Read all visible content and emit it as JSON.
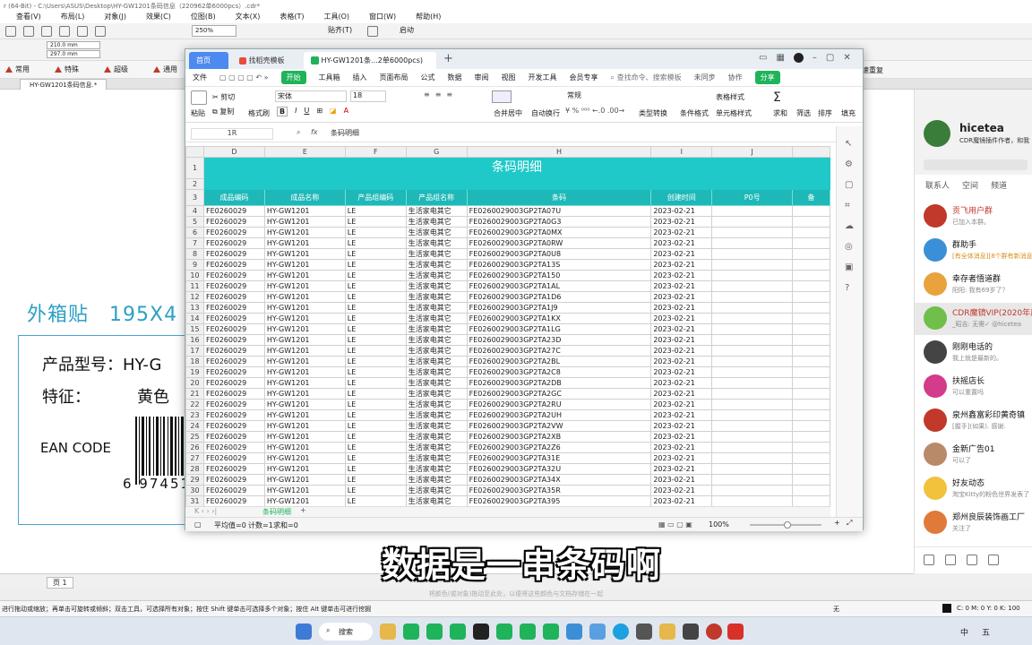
{
  "coreldraw": {
    "title_bar": "r (64-Bit) - C:\\Users\\ASUS\\Desktop\\HY-GW1201条码信息（220962单6000pcs）.cdr*",
    "menu": [
      "查看(V)",
      "布局(L)",
      "对象(J)",
      "效果(C)",
      "位图(B)",
      "文本(X)",
      "表格(T)",
      "工具(O)",
      "窗口(W)",
      "帮助(H)"
    ],
    "zoom": "250%",
    "width_value": "210.0 mm",
    "height_value": "297.0 mm",
    "paste_label": "贴齐(T)",
    "launch_label": "启动",
    "plugins": [
      "常用",
      "特殊",
      "超级",
      "通用"
    ],
    "plugin_right": "速重复",
    "doc_tab": "HY-GW1201条码信息.*",
    "page_tab": "页 1",
    "status_hint": "将颜色(或对象)拖动至此处，以便将这些颜色与文档存储在一起",
    "status_text": "进行拖动或缩放；再单击可旋转或倾斜；双击工具，可选择所有对象；按住 Shift 键单击可选择多个对象；按住 Alt 键单击可进行挖掘",
    "fill_none": "无",
    "color_readout": "C: 0 M: 0 Y: 0 K: 100"
  },
  "label": {
    "title": "外箱贴　195X4",
    "model_label": "产品型号：HY-G",
    "feature_label": "特征：",
    "feature_value": "黄色",
    "ean": "EAN CODE",
    "barcode_digits": "6 97451"
  },
  "wps": {
    "tabs": {
      "home": "首页",
      "template": "找稻壳模板",
      "file": "HY-GW1201条...2单6000pcs)"
    },
    "menu": [
      "文件",
      "开始",
      "工具箱",
      "插入",
      "页面布局",
      "公式",
      "数据",
      "审阅",
      "视图",
      "开发工具",
      "会员专享"
    ],
    "search": "查找命令、搜索模板",
    "unsync": "未同步",
    "collab": "协作",
    "share": "分享",
    "ribbon": {
      "paste": "粘贴",
      "cut": "剪切",
      "copy": "复制",
      "format_painter": "格式刷",
      "font": "宋体",
      "font_size": "18",
      "merge": "合并居中",
      "wrap": "自动换行",
      "number_format": "常规",
      "type_convert": "类型转换",
      "cond_format": "条件格式",
      "table_style": "表格样式",
      "cell_style": "单元格样式",
      "sum": "求和",
      "filter": "筛选",
      "sort": "排序",
      "fill": "填充",
      "bold": "B",
      "italic": "I",
      "underline": "U"
    },
    "cell_ref": "1R",
    "formula_fx": "fx",
    "formula": "条码明细",
    "columns": [
      "D",
      "E",
      "F",
      "G",
      "H",
      "I",
      "J"
    ],
    "sheet_title": "条码明细",
    "headers": [
      "成品编码",
      "成品名称",
      "产品组编码",
      "产品组名称",
      "条码",
      "创建时间",
      "P0号",
      "备"
    ],
    "rows": [
      [
        "4",
        "FE0260029",
        "HY-GW1201",
        "LE",
        "生活家电其它",
        "FE0260029003GP2TA07U",
        "2023-02-21"
      ],
      [
        "5",
        "FE0260029",
        "HY-GW1201",
        "LE",
        "生活家电其它",
        "FE0260029003GP2TA0G3",
        "2023-02-21"
      ],
      [
        "6",
        "FE0260029",
        "HY-GW1201",
        "LE",
        "生活家电其它",
        "FE0260029003GP2TA0MX",
        "2023-02-21"
      ],
      [
        "7",
        "FE0260029",
        "HY-GW1201",
        "LE",
        "生活家电其它",
        "FE0260029003GP2TA0RW",
        "2023-02-21"
      ],
      [
        "8",
        "FE0260029",
        "HY-GW1201",
        "LE",
        "生活家电其它",
        "FE0260029003GP2TA0U8",
        "2023-02-21"
      ],
      [
        "9",
        "FE0260029",
        "HY-GW1201",
        "LE",
        "生活家电其它",
        "FE0260029003GP2TA13S",
        "2023-02-21"
      ],
      [
        "10",
        "FE0260029",
        "HY-GW1201",
        "LE",
        "生活家电其它",
        "FE0260029003GP2TA150",
        "2023-02-21"
      ],
      [
        "11",
        "FE0260029",
        "HY-GW1201",
        "LE",
        "生活家电其它",
        "FE0260029003GP2TA1AL",
        "2023-02-21"
      ],
      [
        "12",
        "FE0260029",
        "HY-GW1201",
        "LE",
        "生活家电其它",
        "FE0260029003GP2TA1D6",
        "2023-02-21"
      ],
      [
        "13",
        "FE0260029",
        "HY-GW1201",
        "LE",
        "生活家电其它",
        "FE0260029003GP2TA1J9",
        "2023-02-21"
      ],
      [
        "14",
        "FE0260029",
        "HY-GW1201",
        "LE",
        "生活家电其它",
        "FE0260029003GP2TA1KX",
        "2023-02-21"
      ],
      [
        "15",
        "FE0260029",
        "HY-GW1201",
        "LE",
        "生活家电其它",
        "FE0260029003GP2TA1LG",
        "2023-02-21"
      ],
      [
        "16",
        "FE0260029",
        "HY-GW1201",
        "LE",
        "生活家电其它",
        "FE0260029003GP2TA23D",
        "2023-02-21"
      ],
      [
        "17",
        "FE0260029",
        "HY-GW1201",
        "LE",
        "生活家电其它",
        "FE0260029003GP2TA27C",
        "2023-02-21"
      ],
      [
        "18",
        "FE0260029",
        "HY-GW1201",
        "LE",
        "生活家电其它",
        "FE0260029003GP2TA2BL",
        "2023-02-21"
      ],
      [
        "19",
        "FE0260029",
        "HY-GW1201",
        "LE",
        "生活家电其它",
        "FE0260029003GP2TA2C8",
        "2023-02-21"
      ],
      [
        "20",
        "FE0260029",
        "HY-GW1201",
        "LE",
        "生活家电其它",
        "FE0260029003GP2TA2DB",
        "2023-02-21"
      ],
      [
        "21",
        "FE0260029",
        "HY-GW1201",
        "LE",
        "生活家电其它",
        "FE0260029003GP2TA2GC",
        "2023-02-21"
      ],
      [
        "22",
        "FE0260029",
        "HY-GW1201",
        "LE",
        "生活家电其它",
        "FE0260029003GP2TA2RU",
        "2023-02-21"
      ],
      [
        "23",
        "FE0260029",
        "HY-GW1201",
        "LE",
        "生活家电其它",
        "FE0260029003GP2TA2UH",
        "2023-02-21"
      ],
      [
        "24",
        "FE0260029",
        "HY-GW1201",
        "LE",
        "生活家电其它",
        "FE0260029003GP2TA2VW",
        "2023-02-21"
      ],
      [
        "25",
        "FE0260029",
        "HY-GW1201",
        "LE",
        "生活家电其它",
        "FE0260029003GP2TA2XB",
        "2023-02-21"
      ],
      [
        "26",
        "FE0260029",
        "HY-GW1201",
        "LE",
        "生活家电其它",
        "FE0260029003GP2TA2Z6",
        "2023-02-21"
      ],
      [
        "27",
        "FE0260029",
        "HY-GW1201",
        "LE",
        "生活家电其它",
        "FE0260029003GP2TA31E",
        "2023-02-21"
      ],
      [
        "28",
        "FE0260029",
        "HY-GW1201",
        "LE",
        "生活家电其它",
        "FE0260029003GP2TA32U",
        "2023-02-21"
      ],
      [
        "29",
        "FE0260029",
        "HY-GW1201",
        "LE",
        "生活家电其它",
        "FE0260029003GP2TA34X",
        "2023-02-21"
      ],
      [
        "30",
        "FE0260029",
        "HY-GW1201",
        "LE",
        "生活家电其它",
        "FE0260029003GP2TA35R",
        "2023-02-21"
      ],
      [
        "31",
        "FE0260029",
        "HY-GW1201",
        "LE",
        "生活家电其它",
        "FE0260029003GP2TA395",
        "2023-02-21"
      ]
    ],
    "sheet_tab": "条码明细",
    "status": {
      "avg": "平均值=0",
      "count": "计数=1",
      "sum": "求和=0",
      "zoom": "100%"
    }
  },
  "qq": {
    "name": "hicetea",
    "signature": "CDR魔镜插件作者，和我",
    "nav": [
      "联系人",
      "空间",
      "频道"
    ],
    "chats": [
      {
        "name": "贡飞用户群",
        "sub": "已加入本群。"
      },
      {
        "name": "群助手",
        "sub": "[有全体消息][8个群有新消息]"
      },
      {
        "name": "幸存者悟道群",
        "sub": "阳阳: 我有69岁了？"
      },
      {
        "name": "CDR魔镜VIP(2020年用",
        "sub": "_昭吉: 无需✓ @hicetea"
      },
      {
        "name": "刚刚电话的",
        "sub": "我上就是最新的。"
      },
      {
        "name": "扶摇店长",
        "sub": "可以重置吗"
      },
      {
        "name": "泉州鑫富彩印黄奇镇",
        "sub": "[握手](如果). 感谢."
      },
      {
        "name": "金新广告01",
        "sub": "可以了"
      },
      {
        "name": "好友动态",
        "sub": "淘宝Kitty的粉色世界发表了"
      },
      {
        "name": "郑州良辰装饰画工厂",
        "sub": "关注了"
      }
    ]
  },
  "taskbar": {
    "search": "搜索",
    "ime": "中",
    "weekday": "五"
  },
  "subtitle": "数据是一串条码啊",
  "colors": {
    "accent_teal": "#1fc9c9",
    "wps_green": "#1fb35a",
    "qq_blue": "#2d9fc4"
  }
}
